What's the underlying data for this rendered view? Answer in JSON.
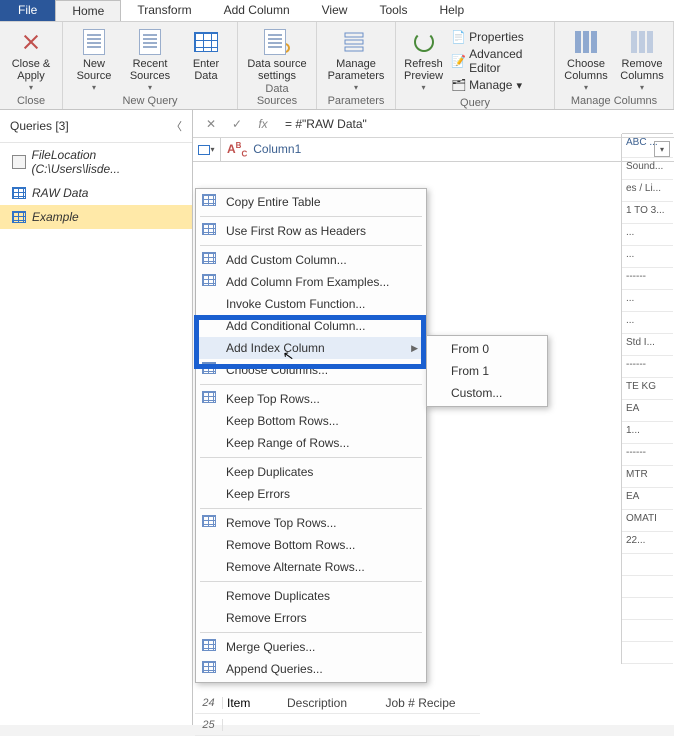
{
  "menubar": {
    "file": "File",
    "tabs": [
      "Home",
      "Transform",
      "Add Column",
      "View",
      "Tools",
      "Help"
    ],
    "active_index": 0
  },
  "ribbon": {
    "close": {
      "close_apply": "Close &\nApply",
      "group": "Close"
    },
    "newquery": {
      "new_source": "New\nSource",
      "recent_sources": "Recent\nSources",
      "enter_data": "Enter\nData",
      "group": "New Query"
    },
    "datasources": {
      "settings": "Data source\nsettings",
      "group": "Data Sources"
    },
    "parameters": {
      "manage": "Manage\nParameters",
      "group": "Parameters"
    },
    "query": {
      "refresh": "Refresh\nPreview",
      "properties": "Properties",
      "adv_editor": "Advanced Editor",
      "manage": "Manage",
      "group": "Query"
    },
    "managecols": {
      "choose": "Choose\nColumns",
      "remove": "Remove\nColumns",
      "group": "Manage Columns"
    }
  },
  "queries": {
    "title": "Queries [3]",
    "items": [
      {
        "label": "FileLocation (C:\\Users\\lisde...",
        "type": "param"
      },
      {
        "label": "RAW Data",
        "type": "table"
      },
      {
        "label": "Example",
        "type": "table",
        "selected": true
      }
    ]
  },
  "formula": {
    "fx": "fx",
    "value": "= #\"RAW Data\""
  },
  "column": {
    "type_prefix": "A",
    "type_suffix": "C",
    "name": "Column1"
  },
  "rightcol": {
    "head": "ABC ...",
    "cells": [
      "Sound...",
      "es / Li...",
      "1 TO 3...",
      "...",
      "...",
      "------",
      "...",
      "...",
      "Std I...",
      "------",
      "TE KG",
      "EA",
      "1...",
      "------",
      "MTR",
      "EA",
      "OMATI",
      "22...",
      "",
      "",
      "",
      "",
      ""
    ]
  },
  "bottom": {
    "r24n": "24",
    "r24c1": "Item",
    "r24c2": "Description",
    "r24c3": "Job #  Recipe",
    "r25n": "25"
  },
  "context": {
    "items": [
      {
        "label": "Copy Entire Table",
        "icon": true
      },
      {
        "sep": true
      },
      {
        "label": "Use First Row as Headers",
        "icon": true
      },
      {
        "sep": true
      },
      {
        "label": "Add Custom Column...",
        "icon": true
      },
      {
        "label": "Add Column From Examples...",
        "icon": true
      },
      {
        "label": "Invoke Custom Function..."
      },
      {
        "label": "Add Conditional Column..."
      },
      {
        "label": "Add Index Column",
        "submenu": true,
        "highlighted": true
      },
      {
        "label": "Choose Columns...",
        "icon": true
      },
      {
        "sep": true
      },
      {
        "label": "Keep Top Rows...",
        "icon": true
      },
      {
        "label": "Keep Bottom Rows..."
      },
      {
        "label": "Keep Range of Rows..."
      },
      {
        "sep": true
      },
      {
        "label": "Keep Duplicates"
      },
      {
        "label": "Keep Errors"
      },
      {
        "sep": true
      },
      {
        "label": "Remove Top Rows...",
        "icon": true
      },
      {
        "label": "Remove Bottom Rows..."
      },
      {
        "label": "Remove Alternate Rows..."
      },
      {
        "sep": true
      },
      {
        "label": "Remove Duplicates"
      },
      {
        "label": "Remove Errors"
      },
      {
        "sep": true
      },
      {
        "label": "Merge Queries...",
        "icon": true
      },
      {
        "label": "Append Queries...",
        "icon": true
      }
    ]
  },
  "submenu": {
    "items": [
      "From 0",
      "From 1",
      "Custom..."
    ]
  }
}
